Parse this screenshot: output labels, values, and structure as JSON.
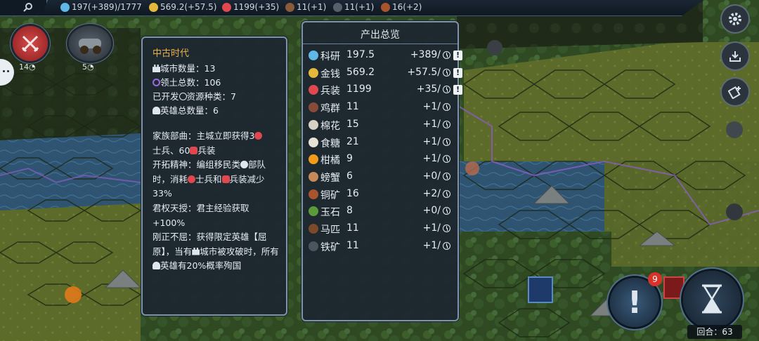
{
  "topbar": {
    "resources": [
      {
        "icon": "science-icon",
        "color": "#5fb8e8",
        "text": "197(+389)/1777"
      },
      {
        "icon": "gold-icon",
        "color": "#e6b83a",
        "text": "569.2(+57.5)"
      },
      {
        "icon": "equipment-icon",
        "color": "#e0474f",
        "text": "1199(+35)"
      },
      {
        "icon": "chicken-icon",
        "color": "#8a5a3a",
        "text": "11(+1)"
      },
      {
        "icon": "iron-icon",
        "color": "#55606a",
        "text": "11(+1)"
      },
      {
        "icon": "copper-icon",
        "color": "#a8552e",
        "text": "16(+2)"
      }
    ]
  },
  "left": {
    "war_count": "14",
    "unit_count": "5"
  },
  "era_panel": {
    "title": "中古时代",
    "city_count": "城市数量：13",
    "territory": "领土总数：106",
    "resources_types": "已开发",
    "resources_types_suffix": "资源种类：7",
    "heroes": "英雄总数量：6",
    "clan_a": "家族部曲：主城立即获得3",
    "clan_b": "士兵、60",
    "clan_c": "兵装",
    "pioneer_a": "开拓精神：编组移民类",
    "pioneer_b": "部队时，消耗",
    "pioneer_c": "士兵和",
    "pioneer_d": "兵装减少33%",
    "divine": "君权天授：君主经验获取+100%",
    "upright_a": "刚正不屈：获得限定英雄【屈原】，当有",
    "upright_b": "城市被攻破时，所有",
    "upright_c": "英雄有20%概率殉国"
  },
  "output_panel": {
    "title": "产出总览",
    "rows": [
      {
        "icon": "science-icon",
        "color": "#5fb8e8",
        "name": "科研",
        "value": "197.5",
        "inc": "+389/",
        "warn": true
      },
      {
        "icon": "gold-icon",
        "color": "#e6b83a",
        "name": "金钱",
        "value": "569.2",
        "inc": "+57.5/",
        "warn": true
      },
      {
        "icon": "equipment-icon",
        "color": "#e0474f",
        "name": "兵装",
        "value": "1199",
        "inc": "+35/",
        "warn": true
      },
      {
        "icon": "chicken-icon",
        "color": "#8a4a3a",
        "name": "鸡群",
        "value": "11",
        "inc": "+1/",
        "warn": false
      },
      {
        "icon": "cotton-icon",
        "color": "#d8d2c4",
        "name": "棉花",
        "value": "15",
        "inc": "+1/",
        "warn": false
      },
      {
        "icon": "sugar-icon",
        "color": "#e8e2d4",
        "name": "食糖",
        "value": "21",
        "inc": "+1/",
        "warn": false
      },
      {
        "icon": "orange-icon",
        "color": "#f29a1a",
        "name": "柑橘",
        "value": "9",
        "inc": "+1/",
        "warn": false
      },
      {
        "icon": "crab-icon",
        "color": "#c98a5a",
        "name": "螃蟹",
        "value": "6",
        "inc": "+0/",
        "warn": false
      },
      {
        "icon": "copper-icon",
        "color": "#a8552e",
        "name": "铜矿",
        "value": "16",
        "inc": "+2/",
        "warn": false
      },
      {
        "icon": "jade-icon",
        "color": "#5a9a3a",
        "name": "玉石",
        "value": "8",
        "inc": "+0/",
        "warn": false
      },
      {
        "icon": "horse-icon",
        "color": "#7a4a2a",
        "name": "马匹",
        "value": "11",
        "inc": "+1/",
        "warn": false
      },
      {
        "icon": "iron-icon",
        "color": "#4a5560",
        "name": "铁矿",
        "value": "11",
        "inc": "+1/",
        "warn": false
      }
    ]
  },
  "right": {
    "alert_badge": "9",
    "turn_label": "回合：63"
  }
}
